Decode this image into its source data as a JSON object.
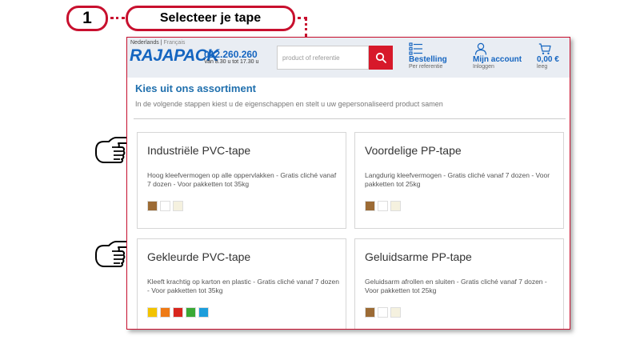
{
  "annotation": {
    "step_number": "1",
    "step_title": "Selecteer je tape",
    "accent_color": "#c8102e"
  },
  "header": {
    "language_current": "Nederlands",
    "language_separator": " | ",
    "language_alt": "Français",
    "logo_main": "RAJAPACK",
    "phone": "012.260.260",
    "hours": "Van 8.30 u tot 17.30 u",
    "search_placeholder": "product of referentie",
    "search_icon": "search-icon",
    "nav": [
      {
        "label": "Bestelling",
        "sub": "Per referentie",
        "icon": "list-icon"
      },
      {
        "label": "Mijn account",
        "sub": "Inloggen",
        "icon": "user-icon"
      },
      {
        "label": "0,00 €",
        "sub": "leeg",
        "icon": "cart-icon"
      }
    ],
    "brand_color": "#1565c0",
    "search_button_color": "#d7192a"
  },
  "content": {
    "title": "Kies uit ons assortiment",
    "subtitle": "In de volgende stappen kiest u de eigenschappen en stelt u uw gepersonaliseerd product samen"
  },
  "products": [
    {
      "title": "Industriële PVC-tape",
      "description": "Hoog kleefvermogen op alle oppervlakken - Gratis cliché vanaf 7 dozen - Voor pakketten tot 35kg",
      "swatches": [
        "#9c6b35",
        "#ffffff",
        "#f5f1df"
      ]
    },
    {
      "title": "Voordelige PP-tape",
      "description": "Langdurig kleefvermogen - Gratis cliché vanaf 7 dozen - Voor pakketten tot 25kg",
      "swatches": [
        "#9c6b35",
        "#ffffff",
        "#f5f1df"
      ]
    },
    {
      "title": "Gekleurde PVC-tape",
      "description": "Kleeft krachtig op karton en plastic - Gratis cliché vanaf 7 dozen - Voor pakketten tot 35kg",
      "swatches": [
        "#f2c300",
        "#ee7a16",
        "#d8261e",
        "#3aa935",
        "#1d9ddb"
      ]
    },
    {
      "title": "Geluidsarme PP-tape",
      "description": "Geluidsarm afrollen en sluiten - Gratis cliché vanaf 7 dozen - Voor pakketten tot 25kg",
      "swatches": [
        "#9c6b35",
        "#ffffff",
        "#f5f1df"
      ]
    }
  ],
  "pointers": [
    "pointing-hand-icon",
    "pointing-hand-icon"
  ]
}
